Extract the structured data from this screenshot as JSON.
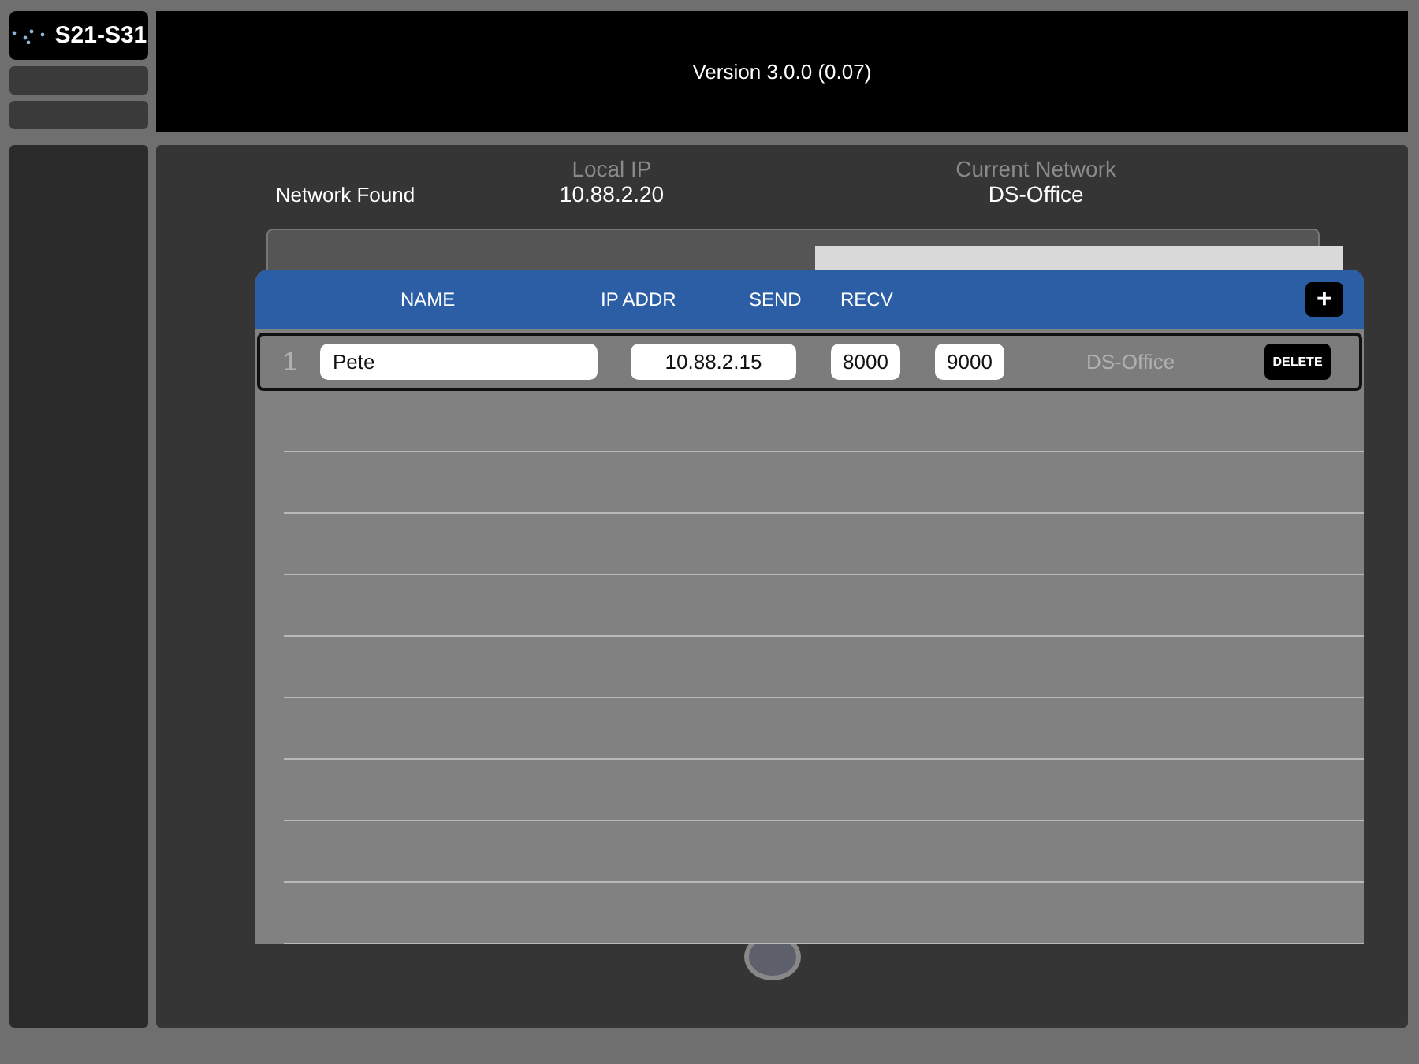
{
  "logo": {
    "label": "S21-S31"
  },
  "header": {
    "version": "Version 3.0.0 (0.07)"
  },
  "network": {
    "status": "Network Found",
    "local_ip_label": "Local IP",
    "local_ip": "10.88.2.20",
    "current_network_label": "Current Network",
    "current_network": "DS-Office"
  },
  "popup": {
    "columns": [
      "NAME",
      "IP ADDR",
      "SEND",
      "RECV"
    ],
    "add_button": "+",
    "rows": [
      {
        "index": "1",
        "name": "Pete",
        "ip": "10.88.2.15",
        "send": "8000",
        "recv": "9000",
        "network": "DS-Office",
        "action": "DELETE",
        "selected": true
      }
    ]
  }
}
